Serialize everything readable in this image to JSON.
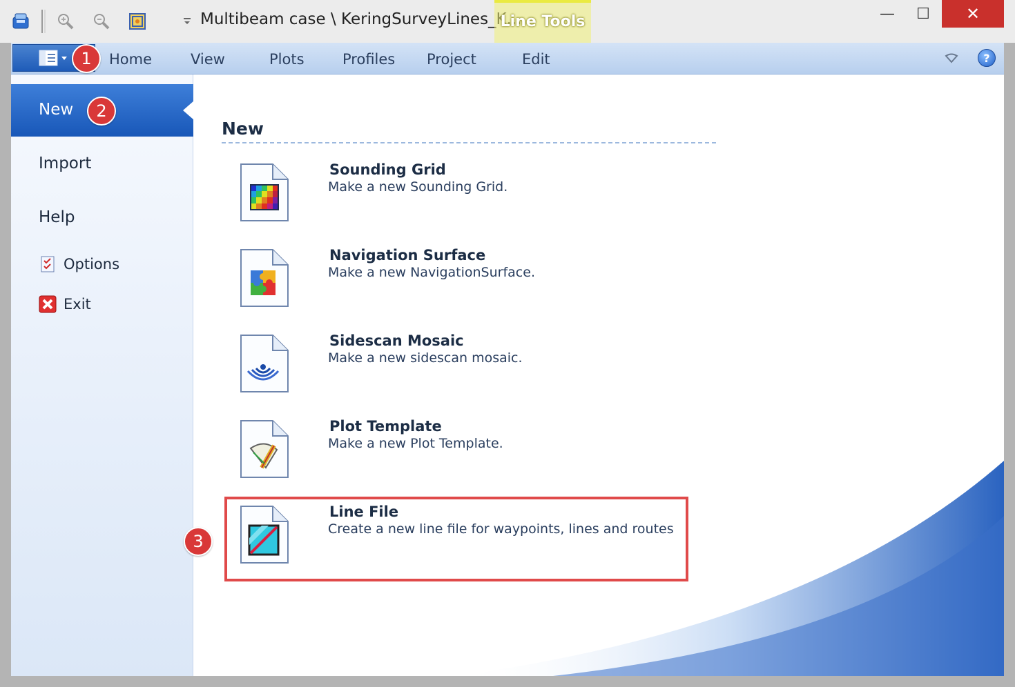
{
  "titlebar": {
    "title": "Multibeam case \\ KeringSurveyLines_K...",
    "contextual_tab_group": "Line Tools",
    "minimize": "—",
    "maximize": "☐",
    "close": "✕"
  },
  "ribbon": {
    "tabs": [
      {
        "label": "Home"
      },
      {
        "label": "View"
      },
      {
        "label": "Plots"
      },
      {
        "label": "Profiles"
      },
      {
        "label": "Project"
      },
      {
        "label": "Edit"
      }
    ],
    "help": "?"
  },
  "backstage": {
    "nav": {
      "new": "New",
      "import": "Import",
      "help": "Help",
      "options": "Options",
      "exit": "Exit"
    },
    "section_title": "New",
    "items": [
      {
        "title": "Sounding Grid",
        "description": "Make a new Sounding Grid.",
        "icon": "sounding-grid-icon"
      },
      {
        "title": "Navigation Surface",
        "description": "Make a new NavigationSurface.",
        "icon": "navigation-surface-icon"
      },
      {
        "title": "Sidescan Mosaic",
        "description": "Make a new sidescan mosaic.",
        "icon": "sidescan-mosaic-icon"
      },
      {
        "title": "Plot Template",
        "description": "Make a new Plot Template.",
        "icon": "plot-template-icon"
      },
      {
        "title": "Line File",
        "description": "Create a new line file for waypoints, lines and routes",
        "icon": "line-file-icon"
      }
    ]
  },
  "callouts": {
    "one": "1",
    "two": "2",
    "three": "3"
  },
  "colors": {
    "accent_blue": "#1e5bb8",
    "callout_red": "#d93838",
    "highlight_yellow": "#eaea40"
  }
}
